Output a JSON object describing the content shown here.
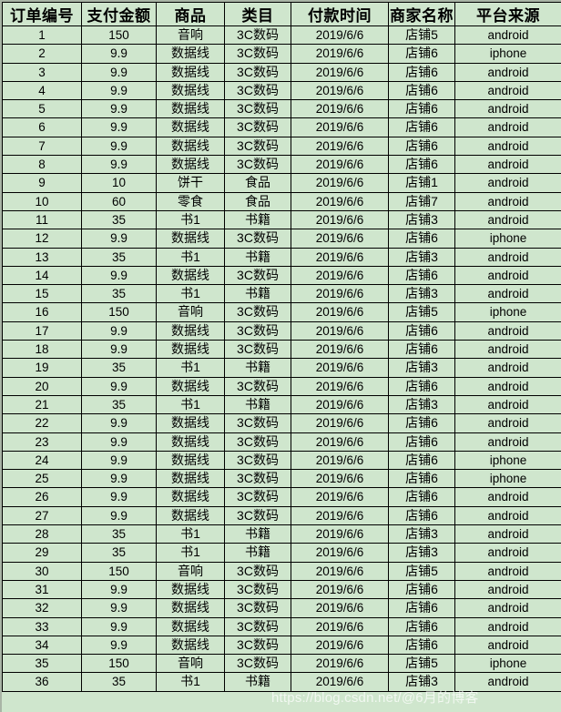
{
  "table": {
    "headers": [
      "订单编号",
      "支付金额",
      "商品",
      "类目",
      "付款时间",
      "商家名称",
      "平台来源"
    ],
    "rows": [
      [
        "1",
        "150",
        "音响",
        "3C数码",
        "2019/6/6",
        "店铺5",
        "android"
      ],
      [
        "2",
        "9.9",
        "数据线",
        "3C数码",
        "2019/6/6",
        "店铺6",
        "iphone"
      ],
      [
        "3",
        "9.9",
        "数据线",
        "3C数码",
        "2019/6/6",
        "店铺6",
        "android"
      ],
      [
        "4",
        "9.9",
        "数据线",
        "3C数码",
        "2019/6/6",
        "店铺6",
        "android"
      ],
      [
        "5",
        "9.9",
        "数据线",
        "3C数码",
        "2019/6/6",
        "店铺6",
        "android"
      ],
      [
        "6",
        "9.9",
        "数据线",
        "3C数码",
        "2019/6/6",
        "店铺6",
        "android"
      ],
      [
        "7",
        "9.9",
        "数据线",
        "3C数码",
        "2019/6/6",
        "店铺6",
        "android"
      ],
      [
        "8",
        "9.9",
        "数据线",
        "3C数码",
        "2019/6/6",
        "店铺6",
        "android"
      ],
      [
        "9",
        "10",
        "饼干",
        "食品",
        "2019/6/6",
        "店铺1",
        "android"
      ],
      [
        "10",
        "60",
        "零食",
        "食品",
        "2019/6/6",
        "店铺7",
        "android"
      ],
      [
        "11",
        "35",
        "书1",
        "书籍",
        "2019/6/6",
        "店铺3",
        "android"
      ],
      [
        "12",
        "9.9",
        "数据线",
        "3C数码",
        "2019/6/6",
        "店铺6",
        "iphone"
      ],
      [
        "13",
        "35",
        "书1",
        "书籍",
        "2019/6/6",
        "店铺3",
        "android"
      ],
      [
        "14",
        "9.9",
        "数据线",
        "3C数码",
        "2019/6/6",
        "店铺6",
        "android"
      ],
      [
        "15",
        "35",
        "书1",
        "书籍",
        "2019/6/6",
        "店铺3",
        "android"
      ],
      [
        "16",
        "150",
        "音响",
        "3C数码",
        "2019/6/6",
        "店铺5",
        "iphone"
      ],
      [
        "17",
        "9.9",
        "数据线",
        "3C数码",
        "2019/6/6",
        "店铺6",
        "android"
      ],
      [
        "18",
        "9.9",
        "数据线",
        "3C数码",
        "2019/6/6",
        "店铺6",
        "android"
      ],
      [
        "19",
        "35",
        "书1",
        "书籍",
        "2019/6/6",
        "店铺3",
        "android"
      ],
      [
        "20",
        "9.9",
        "数据线",
        "3C数码",
        "2019/6/6",
        "店铺6",
        "android"
      ],
      [
        "21",
        "35",
        "书1",
        "书籍",
        "2019/6/6",
        "店铺3",
        "android"
      ],
      [
        "22",
        "9.9",
        "数据线",
        "3C数码",
        "2019/6/6",
        "店铺6",
        "android"
      ],
      [
        "23",
        "9.9",
        "数据线",
        "3C数码",
        "2019/6/6",
        "店铺6",
        "android"
      ],
      [
        "24",
        "9.9",
        "数据线",
        "3C数码",
        "2019/6/6",
        "店铺6",
        "iphone"
      ],
      [
        "25",
        "9.9",
        "数据线",
        "3C数码",
        "2019/6/6",
        "店铺6",
        "iphone"
      ],
      [
        "26",
        "9.9",
        "数据线",
        "3C数码",
        "2019/6/6",
        "店铺6",
        "android"
      ],
      [
        "27",
        "9.9",
        "数据线",
        "3C数码",
        "2019/6/6",
        "店铺6",
        "android"
      ],
      [
        "28",
        "35",
        "书1",
        "书籍",
        "2019/6/6",
        "店铺3",
        "android"
      ],
      [
        "29",
        "35",
        "书1",
        "书籍",
        "2019/6/6",
        "店铺3",
        "android"
      ],
      [
        "30",
        "150",
        "音响",
        "3C数码",
        "2019/6/6",
        "店铺5",
        "android"
      ],
      [
        "31",
        "9.9",
        "数据线",
        "3C数码",
        "2019/6/6",
        "店铺6",
        "android"
      ],
      [
        "32",
        "9.9",
        "数据线",
        "3C数码",
        "2019/6/6",
        "店铺6",
        "android"
      ],
      [
        "33",
        "9.9",
        "数据线",
        "3C数码",
        "2019/6/6",
        "店铺6",
        "android"
      ],
      [
        "34",
        "9.9",
        "数据线",
        "3C数码",
        "2019/6/6",
        "店铺6",
        "android"
      ],
      [
        "35",
        "150",
        "音响",
        "3C数码",
        "2019/6/6",
        "店铺5",
        "iphone"
      ],
      [
        "36",
        "35",
        "书1",
        "书籍",
        "2019/6/6",
        "店铺3",
        "android"
      ]
    ]
  },
  "watermark": {
    "text": "https://blog.csdn.net/@6月的博客"
  },
  "colors": {
    "cell_fill": "#cfe6cd",
    "grid_line": "#000000",
    "outer_edge": "#a9b5a6",
    "text": "#000000"
  }
}
